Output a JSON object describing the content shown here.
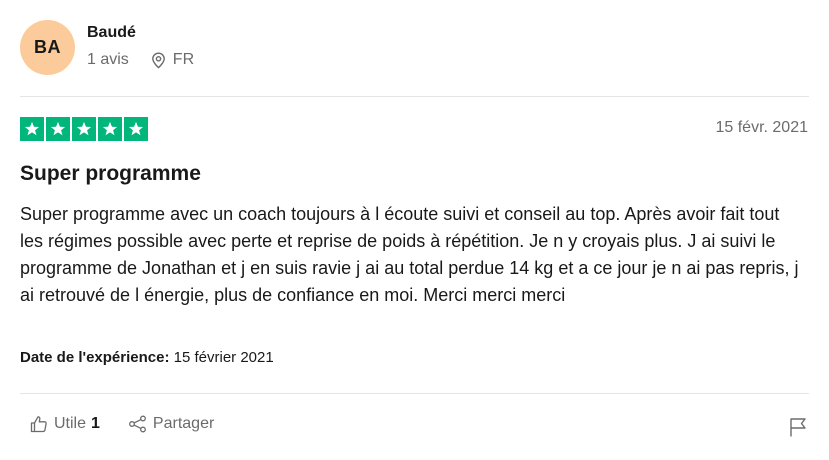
{
  "reviewer": {
    "initials": "BA",
    "name": "Baudé",
    "reviews_count": "1 avis",
    "country": "FR"
  },
  "review": {
    "rating": 5,
    "max_rating": 5,
    "date": "15 févr. 2021",
    "title": "Super programme",
    "body": "Super programme avec un coach toujours à l écoute suivi et conseil au top. Après avoir fait tout les régimes possible avec perte et reprise de poids à répétition. Je n y croyais plus. J ai suivi le programme de Jonathan et j en suis ravie j ai au total perdue 14 kg et a ce jour je n ai pas repris, j ai retrouvé de l énergie, plus de confiance en moi. Merci merci merci",
    "experience_label": "Date de l'expérience:",
    "experience_date": "15 février 2021"
  },
  "actions": {
    "useful_label": "Utile",
    "useful_count": "1",
    "share_label": "Partager"
  },
  "icons": {
    "location": "map-pin-icon",
    "star": "star-icon",
    "useful": "thumbs-up-icon",
    "share": "share-icon",
    "report": "flag-icon"
  },
  "colors": {
    "star_fill": "#00b67a",
    "avatar_bg": "#fbcb9b",
    "muted_text": "#6b6b6b",
    "divider": "#e5e5e5"
  }
}
